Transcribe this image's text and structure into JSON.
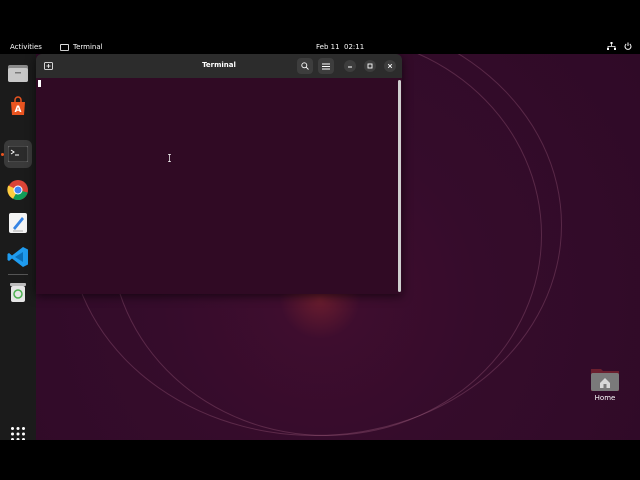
{
  "topbar": {
    "activities": "Activities",
    "app_name": "Terminal",
    "date": "Feb 11",
    "time": "02:11"
  },
  "window": {
    "title": "Terminal"
  },
  "desktop": {
    "home_label": "Home"
  },
  "dock": {
    "items": [
      "files-icon",
      "app-center-icon",
      "terminal-icon",
      "chrome-icon",
      "text-editor-icon",
      "vscode-icon",
      "trash-icon"
    ]
  },
  "colors": {
    "terminal_bg": "#300a24",
    "accent": "#e95420",
    "headerbar": "#2c2c2c"
  }
}
